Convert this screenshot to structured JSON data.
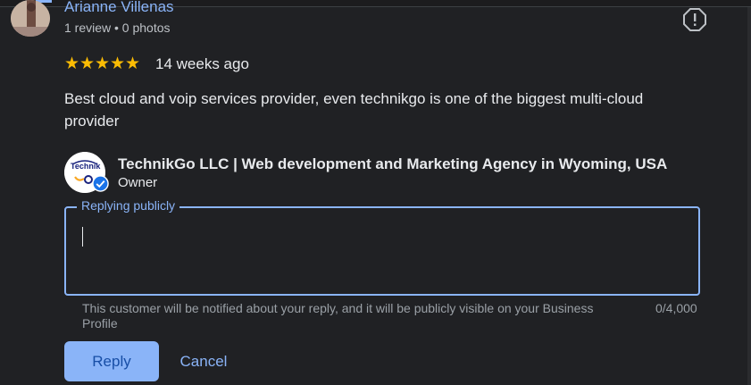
{
  "reviewer": {
    "name": "Arianne Villenas",
    "meta": "1 review • 0 photos"
  },
  "review": {
    "rating": 5,
    "stars": [
      "★",
      "★",
      "★",
      "★",
      "★"
    ],
    "time": "14 weeks ago",
    "text": "Best cloud and voip services provider, even technikgo is one of the biggest multi-cloud provider"
  },
  "owner": {
    "logo_text": "Technik",
    "name": "TechnikGo LLC | Web development and Marketing Agency in Wyoming, USA",
    "role": "Owner"
  },
  "reply": {
    "label": "Replying publicly",
    "value": "",
    "helper": "This customer will be notified about your reply, and it will be publicly visible on your Business Profile",
    "counter": "0/4,000"
  },
  "actions": {
    "reply_label": "Reply",
    "cancel_label": "Cancel"
  },
  "colors": {
    "accent": "#8ab4f8",
    "star": "#fbbc04",
    "background": "#202124"
  },
  "icons": {
    "report": "report-flag-icon",
    "verified": "verified-check-icon"
  }
}
